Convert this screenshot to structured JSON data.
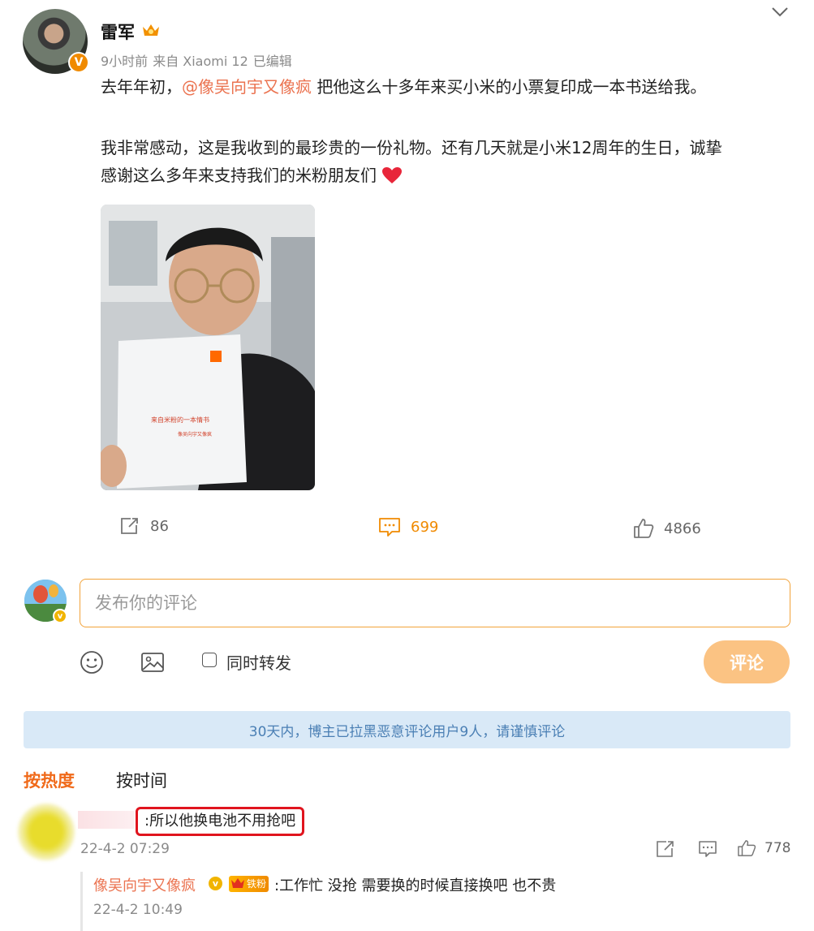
{
  "post": {
    "author": "雷军",
    "time": "9小时前",
    "source": "来自 Xiaomi 12",
    "edited": "已编辑",
    "text_line1_pre": "去年年初，",
    "mention": "@像吴向宇又像疯",
    "text_line1_post": " 把他这么十多年来买小米的小票复印成一本书送给我。",
    "text_line2": "我非常感动，这是我收到的最珍贵的一份礼物。还有几天就是小米12周年的生日，诚挚",
    "text_line3": "感谢这么多年来支持我们的米粉朋友们",
    "photo_book_title": "来自米粉的一本情书",
    "photo_book_sub": "像吴向宇又像疯"
  },
  "actions": {
    "repost_count": "86",
    "comment_count": "699",
    "like_count": "4866"
  },
  "composer": {
    "placeholder": "发布你的评论",
    "repost_label": "同时转发",
    "submit_label": "评论"
  },
  "notice": "30天内，博主已拉黑恶意评论用户9人，请谨慎评论",
  "sort": {
    "hot": "按热度",
    "time": "按时间"
  },
  "comment": {
    "text": ":所以他换电池不用抢吧",
    "time": "22-4-2 07:29",
    "like_count": "778"
  },
  "reply": {
    "name": "像吴向宇又像疯",
    "fan_badge": "铁粉",
    "text": ":工作忙 没抢  需要换的时候直接换吧 也不贵",
    "time": "22-4-2 10:49"
  },
  "colors": {
    "accent_orange": "#f08a00",
    "mention": "#eb7350",
    "submit_bg": "#fbc383",
    "notice_bg": "#d9e9f7",
    "highlight_box": "#e0141e"
  }
}
